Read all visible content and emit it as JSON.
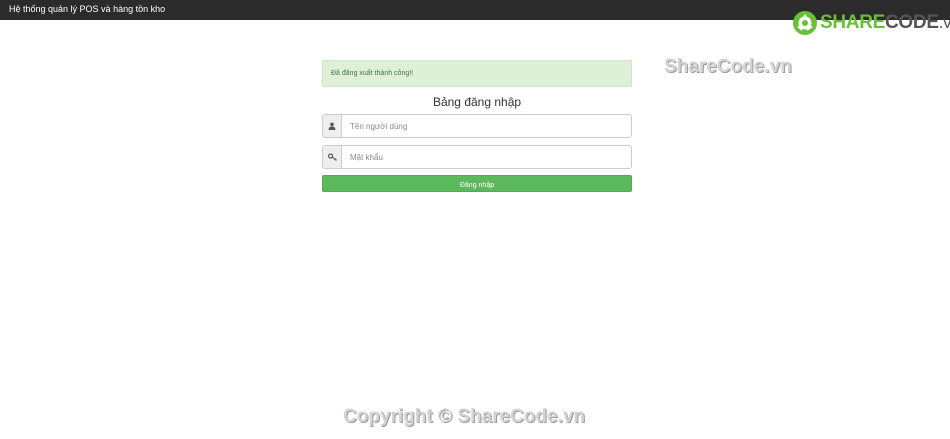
{
  "app": {
    "title": "Hệ thống quản lý POS và hàng tồn kho"
  },
  "branding": {
    "logo_part1": "SHARE",
    "logo_part2": "CODE",
    "logo_suffix": ".vn",
    "watermark_top": "ShareCode.vn",
    "watermark_bottom": "Copyright © ShareCode.vn",
    "colors": {
      "logo_green": "#6abf3a",
      "logo_gray": "#555555"
    }
  },
  "alert": {
    "message": "Đã đăng xuất thành công!!",
    "color": "#dff0d8"
  },
  "login": {
    "title": "Bảng đăng nhập",
    "username_placeholder": "Tên người dùng",
    "username_icon": "user-icon",
    "password_placeholder": "Mật khẩu",
    "password_icon": "key-icon",
    "submit_label": "Đăng nhập",
    "submit_color": "#5cb85c"
  }
}
